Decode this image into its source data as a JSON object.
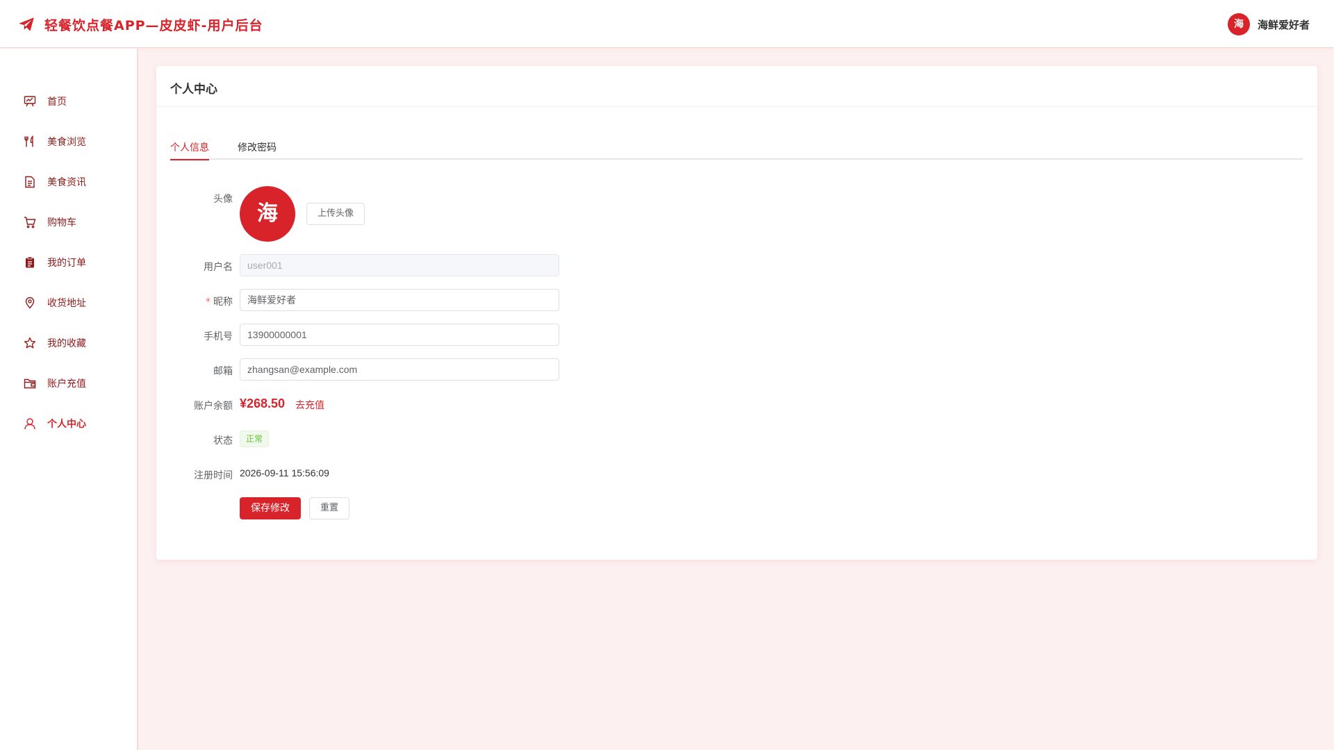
{
  "header": {
    "app_title": "轻餐饮点餐APP—皮皮虾-用户后台",
    "user_avatar_char": "海",
    "user_name": "海鲜爱好者",
    "logo_icon": "paper-plane-icon"
  },
  "sidebar": {
    "items": [
      {
        "label": "首页",
        "icon": "presentation-chart-icon",
        "active": false
      },
      {
        "label": "美食浏览",
        "icon": "fork-knife-icon",
        "active": false
      },
      {
        "label": "美食资讯",
        "icon": "document-icon",
        "active": false
      },
      {
        "label": "购物车",
        "icon": "shopping-cart-icon",
        "active": false
      },
      {
        "label": "我的订单",
        "icon": "clipboard-icon",
        "active": false
      },
      {
        "label": "收货地址",
        "icon": "location-pin-icon",
        "active": false
      },
      {
        "label": "我的收藏",
        "icon": "star-icon",
        "active": false
      },
      {
        "label": "账户充值",
        "icon": "wallet-icon",
        "active": false
      },
      {
        "label": "个人中心",
        "icon": "user-icon",
        "active": true
      }
    ]
  },
  "main": {
    "title": "个人中心",
    "tabs": [
      {
        "label": "个人信息",
        "active": true
      },
      {
        "label": "修改密码",
        "active": false
      }
    ],
    "form": {
      "avatar_label": "头像",
      "avatar_char": "海",
      "upload_button": "上传头像",
      "username_label": "用户名",
      "username_value": "user001",
      "nickname_required_mark": "*",
      "nickname_label": "昵称",
      "nickname_value": "海鲜爱好者",
      "phone_label": "手机号",
      "phone_value": "13900000001",
      "email_label": "邮箱",
      "email_value": "zhangsan@example.com",
      "balance_label": "账户余额",
      "balance_value": "¥268.50",
      "recharge_link": "去充值",
      "status_label": "状态",
      "status_value": "正常",
      "register_time_label": "注册时间",
      "register_time_value": "2026-09-11 15:56:09",
      "save_button": "保存修改",
      "reset_button": "重置"
    }
  },
  "colors": {
    "brand": "#d8232a",
    "page_background": "#fdf0f0",
    "sidebar_text": "#8f1a1a",
    "success": "#67c23a"
  }
}
